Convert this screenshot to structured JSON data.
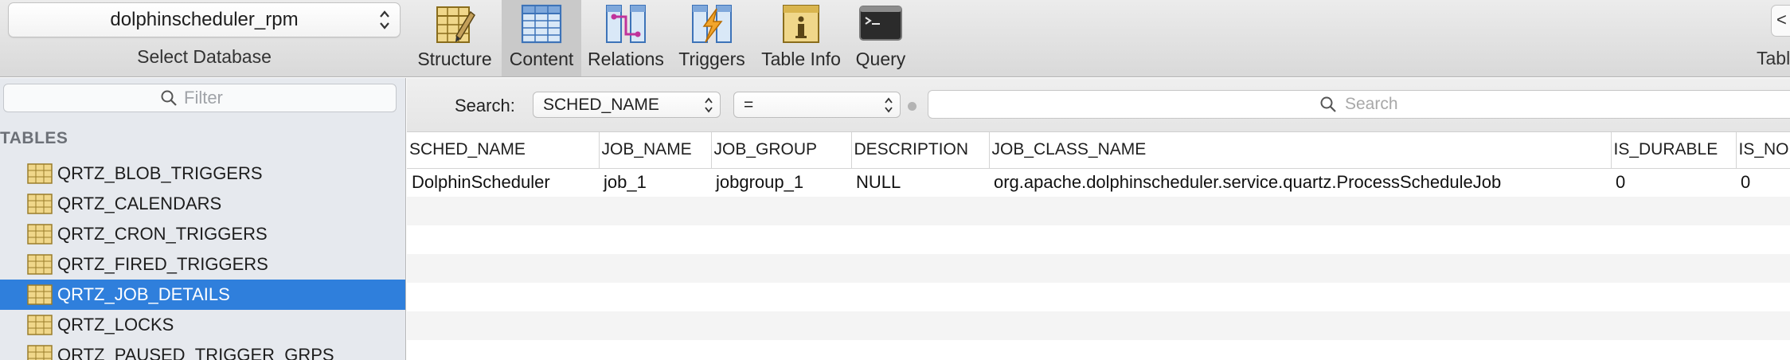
{
  "toolbar": {
    "database": "dolphinscheduler_rpm",
    "database_label": "Select Database",
    "buttons": [
      {
        "label": "Structure",
        "icon": "structure-icon"
      },
      {
        "label": "Content",
        "icon": "content-icon"
      },
      {
        "label": "Relations",
        "icon": "relations-icon"
      },
      {
        "label": "Triggers",
        "icon": "triggers-icon"
      },
      {
        "label": "Table Info",
        "icon": "table-info-icon"
      },
      {
        "label": "Query",
        "icon": "query-icon"
      }
    ],
    "right_label": "Tabl",
    "right_button": "<"
  },
  "sidebar": {
    "filter_placeholder": "Filter",
    "section": "TABLES",
    "items": [
      "QRTZ_BLOB_TRIGGERS",
      "QRTZ_CALENDARS",
      "QRTZ_CRON_TRIGGERS",
      "QRTZ_FIRED_TRIGGERS",
      "QRTZ_JOB_DETAILS",
      "QRTZ_LOCKS",
      "QRTZ_PAUSED_TRIGGER_GRPS"
    ],
    "selected_item": "QRTZ_JOB_DETAILS"
  },
  "filterbar": {
    "label": "Search:",
    "field": "SCHED_NAME",
    "operator": "=",
    "search_placeholder": "Search"
  },
  "grid": {
    "columns": [
      "SCHED_NAME",
      "JOB_NAME",
      "JOB_GROUP",
      "DESCRIPTION",
      "JOB_CLASS_NAME",
      "IS_DURABLE",
      "IS_NONCONCURRENT"
    ],
    "rows": [
      [
        "DolphinScheduler",
        "job_1",
        "jobgroup_1",
        "NULL",
        "org.apache.dolphinscheduler.service.quartz.ProcessScheduleJob",
        "0",
        "0"
      ]
    ]
  },
  "colors": {
    "selection": "#2f7fdc",
    "sidebar_bg": "#e6e9ee",
    "null_text": "#9e9e9e"
  }
}
